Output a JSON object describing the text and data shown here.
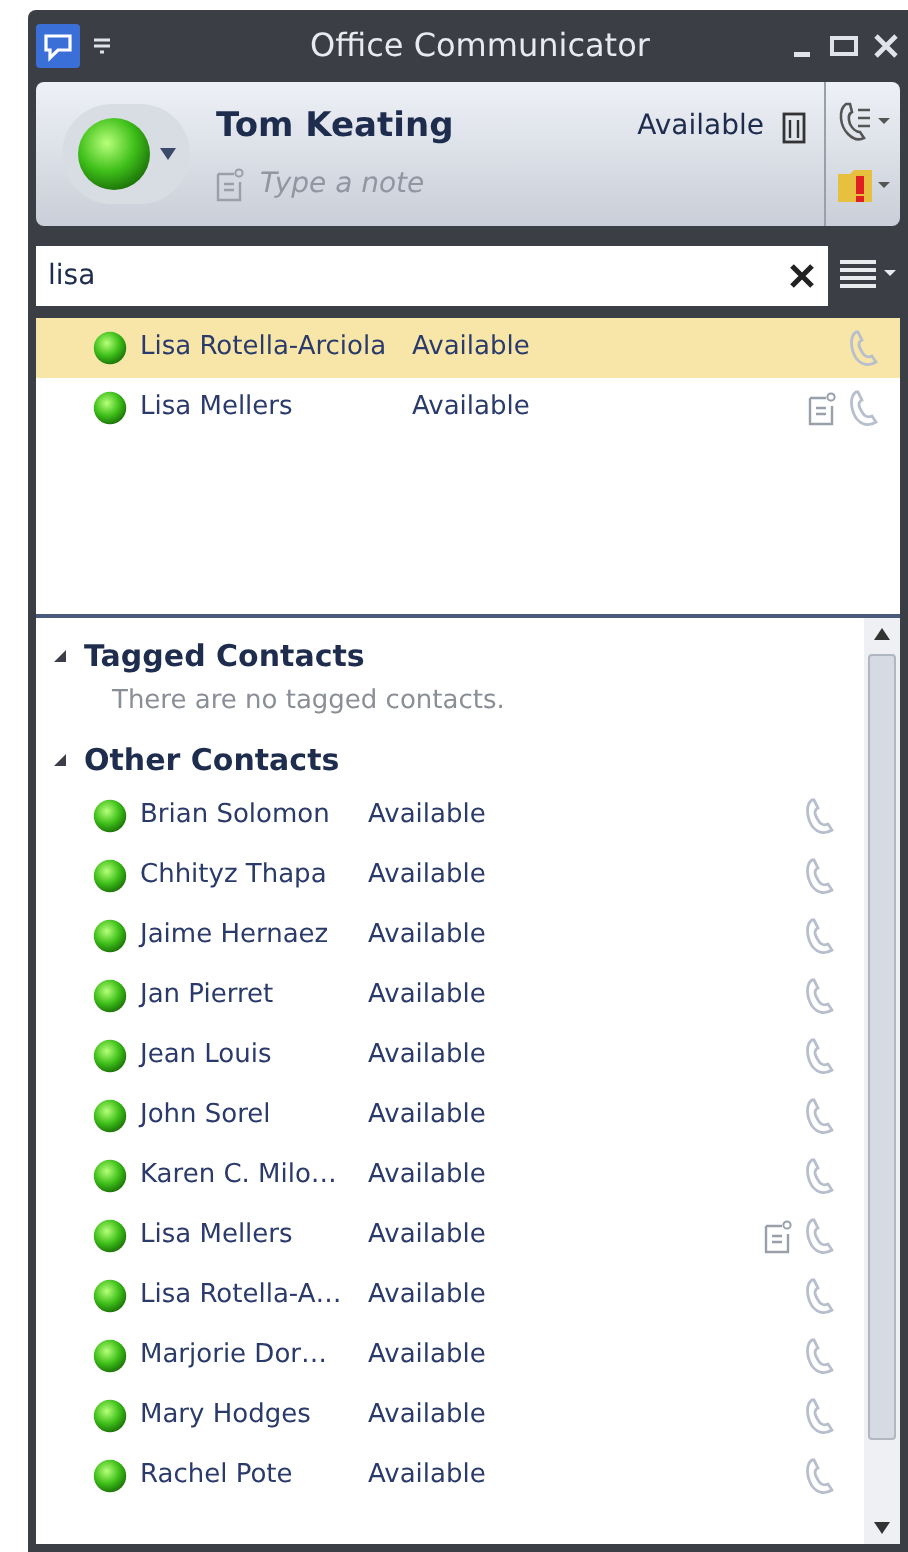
{
  "window": {
    "title": "Office Communicator"
  },
  "user": {
    "name": "Tom Keating",
    "status": "Available",
    "note_placeholder": "Type a note"
  },
  "search": {
    "value": "lisa"
  },
  "results": [
    {
      "name": "Lisa Rotella-Arciola",
      "status": "Available",
      "selected": true,
      "note": false
    },
    {
      "name": "Lisa Mellers",
      "status": "Available",
      "selected": false,
      "note": true
    }
  ],
  "groups": [
    {
      "title": "Tagged Contacts",
      "expanded": true,
      "empty_message": "There are no tagged contacts."
    },
    {
      "title": "Other Contacts",
      "expanded": true,
      "contacts": [
        {
          "name": "Brian Solomon",
          "status": "Available",
          "note": false
        },
        {
          "name": "Chhityz Thapa",
          "status": "Available",
          "note": false
        },
        {
          "name": "Jaime Hernaez",
          "status": "Available",
          "note": false
        },
        {
          "name": "Jan Pierret",
          "status": "Available",
          "note": false
        },
        {
          "name": "Jean Louis",
          "status": "Available",
          "note": false
        },
        {
          "name": "John Sorel",
          "status": "Available",
          "note": false
        },
        {
          "name": "Karen C. Milo…",
          "status": "Available",
          "note": false
        },
        {
          "name": "Lisa Mellers",
          "status": "Available",
          "note": true
        },
        {
          "name": "Lisa Rotella-A…",
          "status": "Available",
          "note": false
        },
        {
          "name": "Marjorie Dor…",
          "status": "Available",
          "note": false
        },
        {
          "name": "Mary Hodges",
          "status": "Available",
          "note": false
        },
        {
          "name": "Rachel Pote",
          "status": "Available",
          "note": false
        }
      ]
    }
  ]
}
